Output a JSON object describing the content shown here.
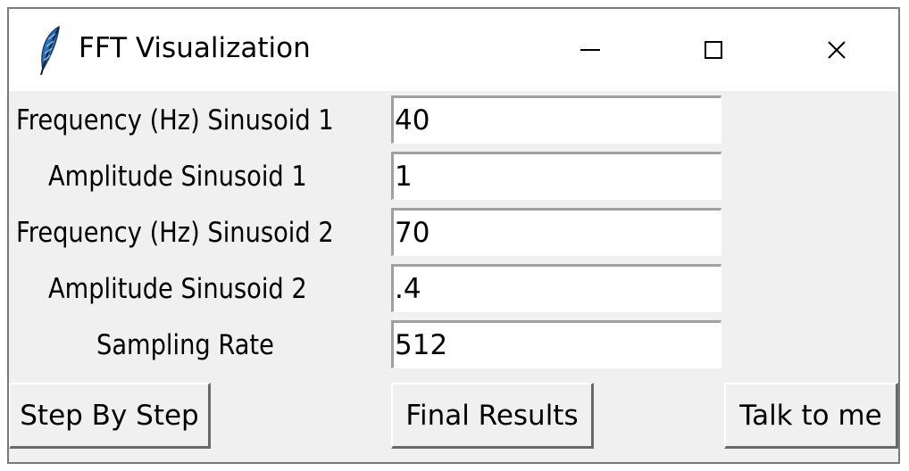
{
  "window": {
    "title": "FFT Visualization",
    "icon": "feather-icon"
  },
  "titlebar_buttons": {
    "minimize_icon": "minimize-icon",
    "maximize_icon": "maximize-icon",
    "close_icon": "close-icon"
  },
  "form": {
    "fields": [
      {
        "label": "Frequency (Hz) Sinusoid 1",
        "value": "40"
      },
      {
        "label": "Amplitude Sinusoid 1",
        "value": "1"
      },
      {
        "label": "Frequency (Hz) Sinusoid 2",
        "value": "70"
      },
      {
        "label": "Amplitude Sinusoid 2",
        "value": ".4"
      },
      {
        "label": "Sampling Rate",
        "value": "512"
      }
    ]
  },
  "buttons": {
    "step_by_step": "Step By Step",
    "final_results": "Final Results",
    "talk_to_me": "Talk to me"
  },
  "colors": {
    "window_bg": "#f0f0f0",
    "titlebar_bg": "#ffffff",
    "feather_blue": "#2f6fb5"
  }
}
